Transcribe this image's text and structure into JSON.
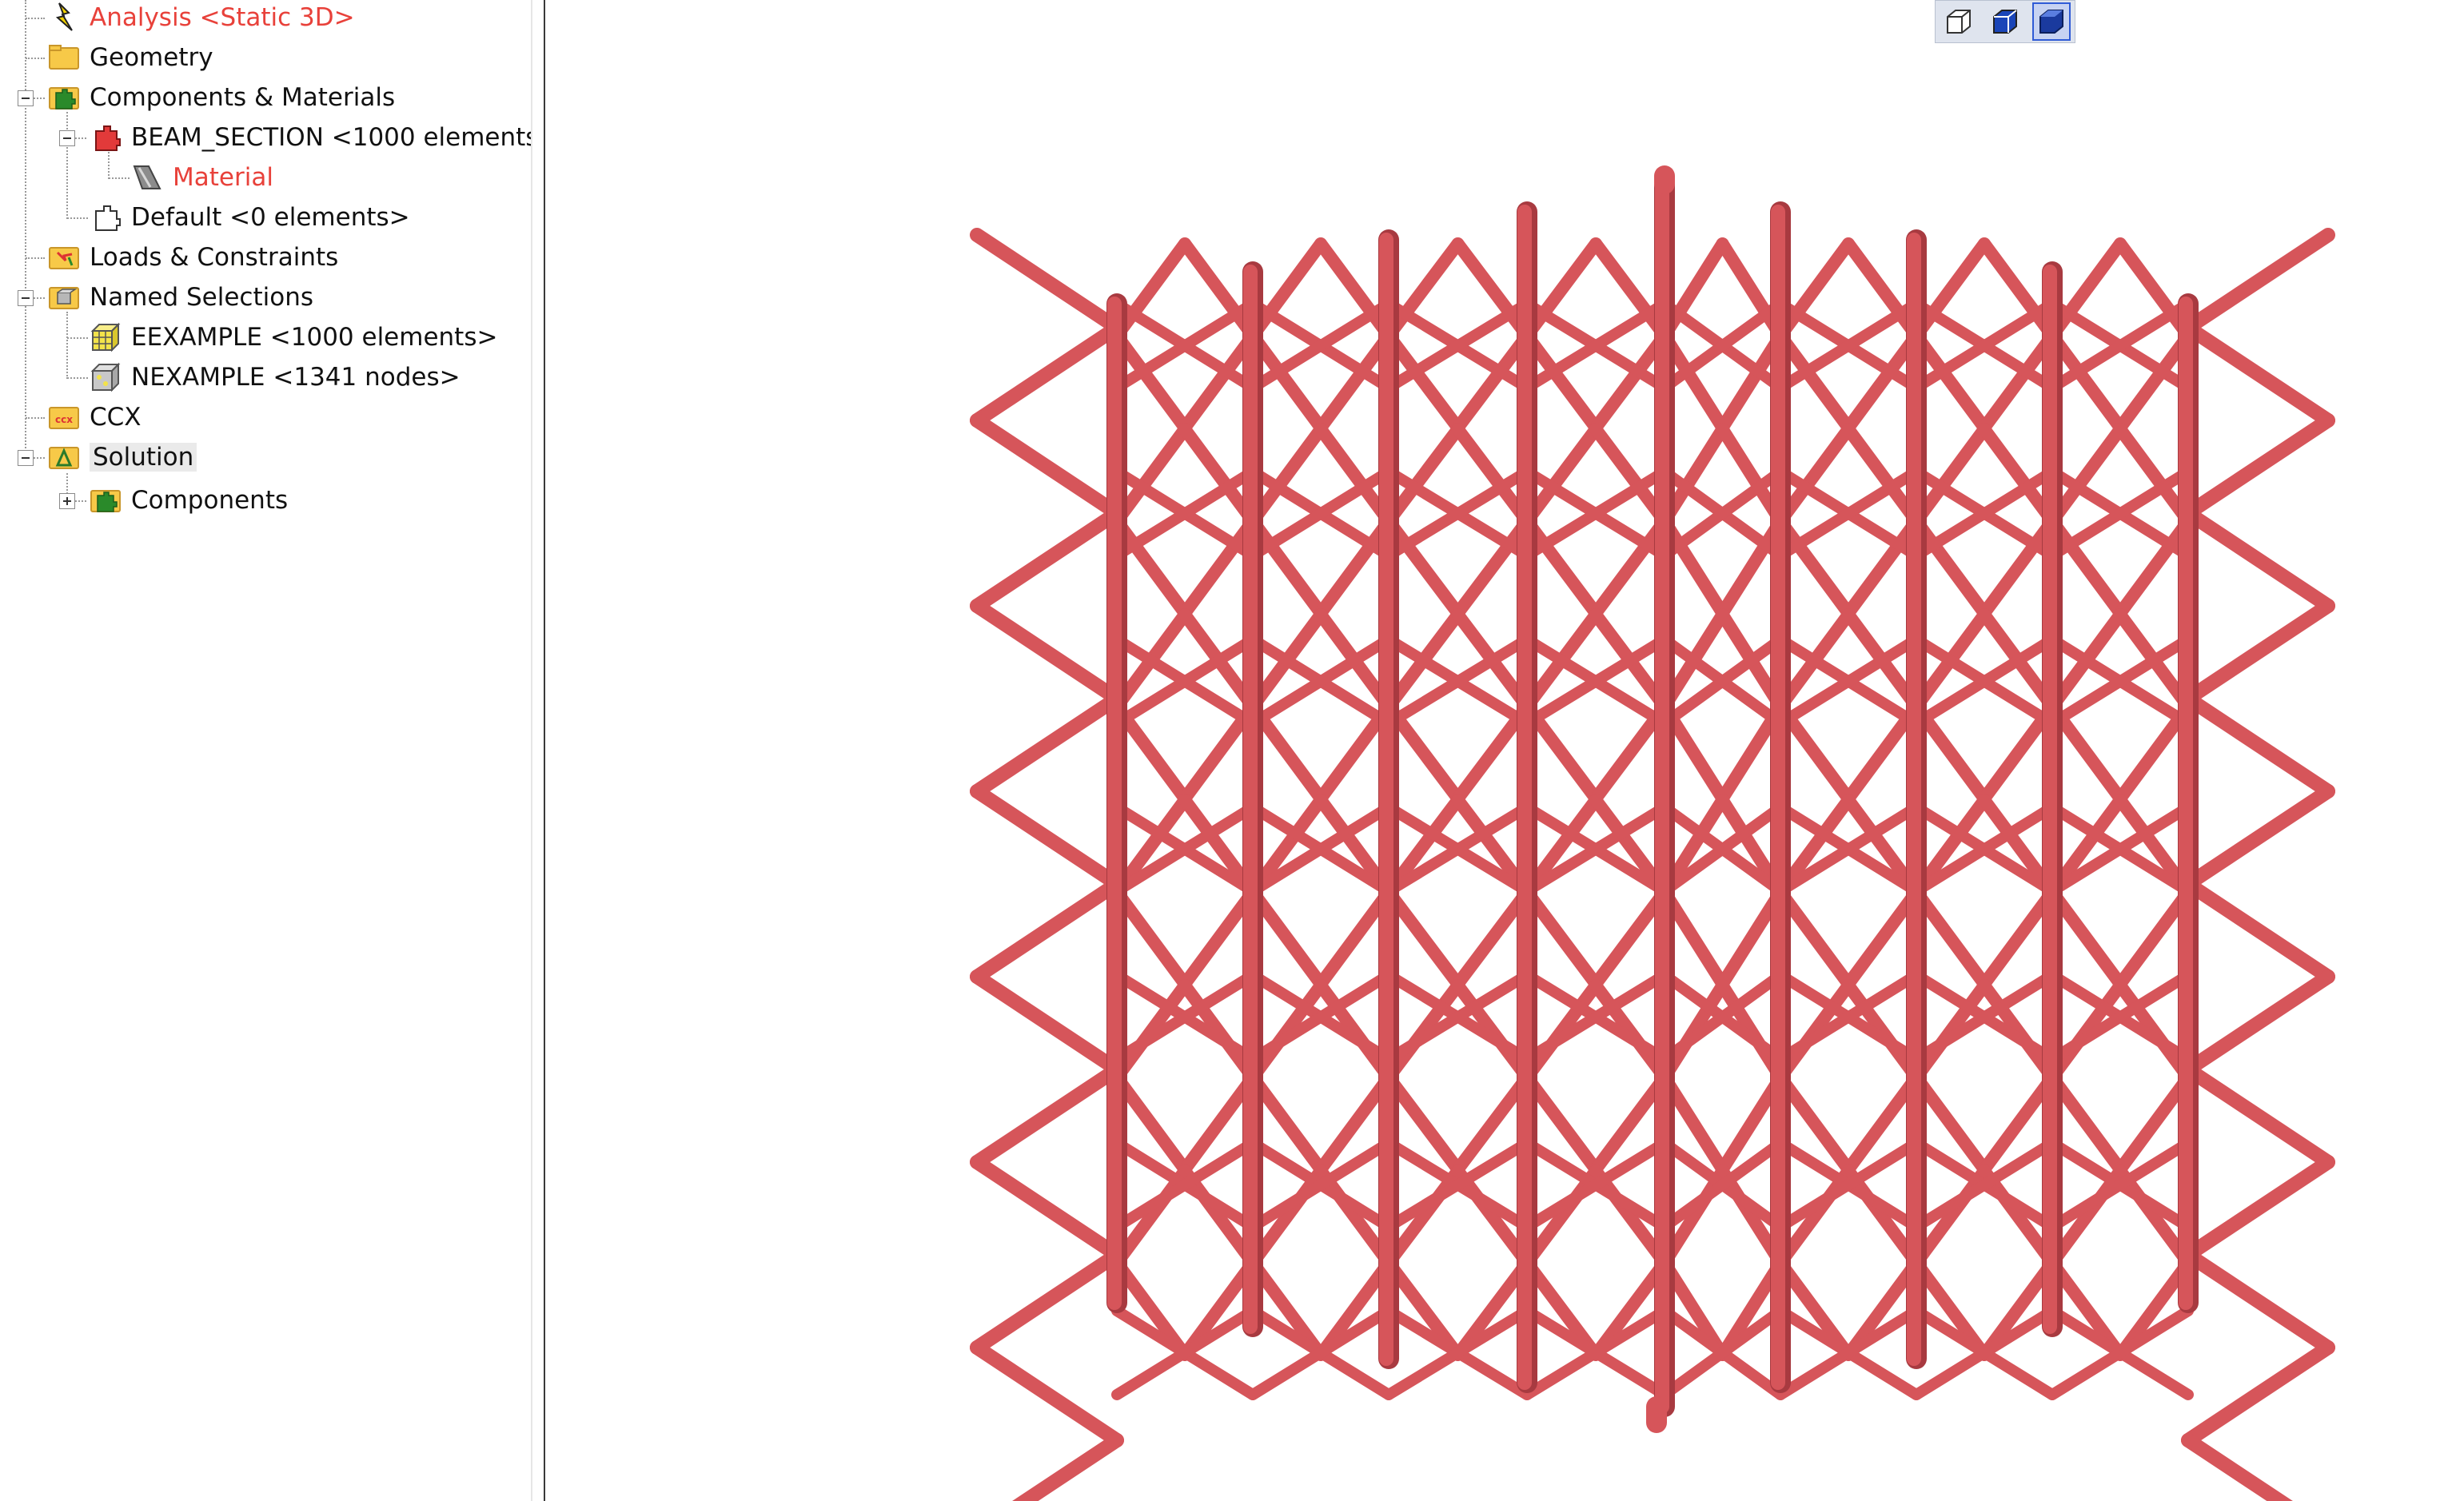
{
  "tree": {
    "items": [
      {
        "label": "Analysis <Static 3D>",
        "icon": "analysis-icon",
        "level": 0,
        "color": "#e8413a"
      },
      {
        "label": "Geometry",
        "icon": "geometry-folder-icon",
        "level": 0
      },
      {
        "label": "Components & Materials",
        "icon": "components-icon",
        "level": 0,
        "expanded": true
      },
      {
        "label": "BEAM_SECTION <1000 elements",
        "icon": "beam-section-icon",
        "level": 1,
        "expanded": true
      },
      {
        "label": "Material",
        "icon": "material-icon",
        "level": 2,
        "color": "#e8413a"
      },
      {
        "label": "Default <0 elements>",
        "icon": "default-section-icon",
        "level": 1
      },
      {
        "label": "Loads & Constraints",
        "icon": "loads-icon",
        "level": 0
      },
      {
        "label": "Named Selections",
        "icon": "named-selections-icon",
        "level": 0,
        "expanded": true
      },
      {
        "label": "EEXAMPLE <1000 elements>",
        "icon": "element-selection-icon",
        "level": 1
      },
      {
        "label": "NEXAMPLE <1341 nodes>",
        "icon": "node-selection-icon",
        "level": 1
      },
      {
        "label": "CCX",
        "icon": "ccx-icon",
        "level": 0
      },
      {
        "label": "Solution",
        "icon": "solution-icon",
        "level": 0,
        "expanded": true,
        "selected": true
      },
      {
        "label": "Components",
        "icon": "components-icon",
        "level": 1,
        "collapsed": true
      }
    ]
  },
  "toolbar": {
    "buttons": [
      {
        "icon": "wireframe-view-icon",
        "active": false
      },
      {
        "icon": "hidden-line-view-icon",
        "active": false
      },
      {
        "icon": "shaded-view-icon",
        "active": true
      }
    ]
  },
  "model": {
    "color": "#d6555a",
    "shade": "#a83a40",
    "grid": 5
  }
}
